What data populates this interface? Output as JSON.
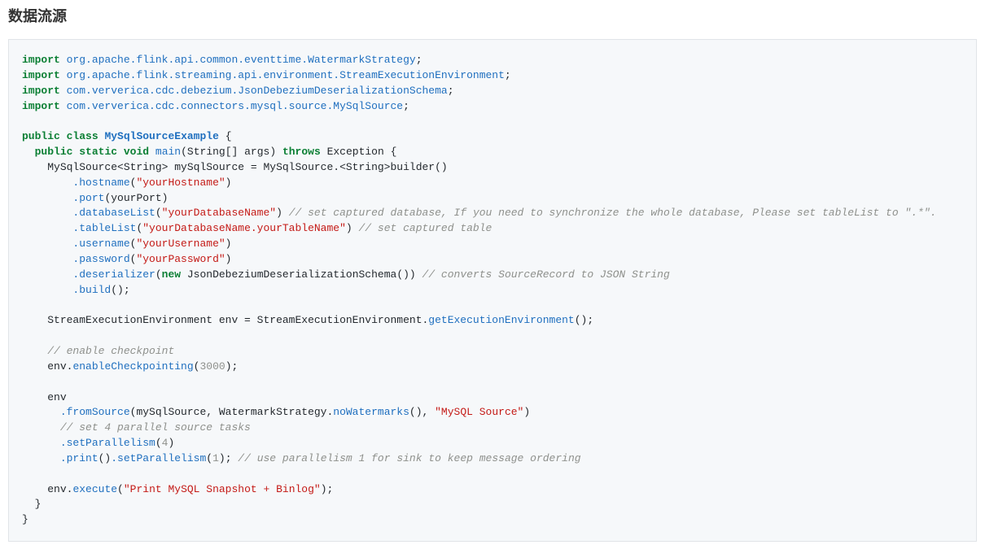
{
  "heading": "数据流源",
  "code": {
    "imports": [
      {
        "kw": "import",
        "path": "org.apache.flink.api.common.eventtime.WatermarkStrategy"
      },
      {
        "kw": "import",
        "path": "org.apache.flink.streaming.api.environment.StreamExecutionEnvironment"
      },
      {
        "kw": "import",
        "path": "com.ververica.cdc.debezium.JsonDebeziumDeserializationSchema"
      },
      {
        "kw": "import",
        "path": "com.ververica.cdc.connectors.mysql.source.MySqlSource"
      }
    ],
    "kw_public": "public",
    "kw_class": "class",
    "class_name": "MySqlSourceExample",
    "kw_static": "static",
    "kw_void": "void",
    "method_main": "main",
    "main_args": "(String[] args)",
    "kw_throws": "throws",
    "exception_type": "Exception",
    "decl_prefix": "MySqlSource<String> mySqlSource = MySqlSource.<String>builder()",
    "chain": {
      "hostname_m": ".hostname",
      "hostname_v": "\"yourHostname\"",
      "port_m": ".port",
      "port_v": "(yourPort)",
      "dblist_m": ".databaseList",
      "dblist_v": "\"yourDatabaseName\"",
      "dblist_c": "// set captured database, If you need to synchronize the whole database, Please set tableList to \".*\".",
      "tablelist_m": ".tableList",
      "tablelist_v": "\"yourDatabaseName.yourTableName\"",
      "tablelist_c": "// set captured table",
      "user_m": ".username",
      "user_v": "\"yourUsername\"",
      "pass_m": ".password",
      "pass_v": "\"yourPassword\"",
      "deser_m": ".deserializer",
      "kw_new": "new",
      "deser_ctor": "JsonDebeziumDeserializationSchema()",
      "deser_c": "// converts SourceRecord to JSON String",
      "build_m": ".build",
      "build_tail": "();"
    },
    "env_decl_pre": "StreamExecutionEnvironment env = StreamExecutionEnvironment.",
    "env_get": "getExecutionEnvironment",
    "env_tail": "();",
    "comment_checkpoint": "// enable checkpoint",
    "enable_cp_pre": "env.",
    "enable_cp_m": "enableCheckpointing",
    "enable_cp_arg": "3000",
    "env_var": "env",
    "from_source_m": ".fromSource",
    "from_source_pre": "(mySqlSource, WatermarkStrategy.",
    "no_wm_m": "noWatermarks",
    "from_source_mid": "(), ",
    "mysql_source_str": "\"MySQL Source\"",
    "comment_parallel": "// set 4 parallel source tasks",
    "set_par_m": ".setParallelism",
    "set_par_arg": "4",
    "print_m": ".print",
    "set_par2_m": ".setParallelism",
    "set_par2_arg": "1",
    "comment_sink": "// use parallelism 1 for sink to keep message ordering",
    "exec_pre": "env.",
    "exec_m": "execute",
    "exec_str": "\"Print MySQL Snapshot + Binlog\""
  }
}
